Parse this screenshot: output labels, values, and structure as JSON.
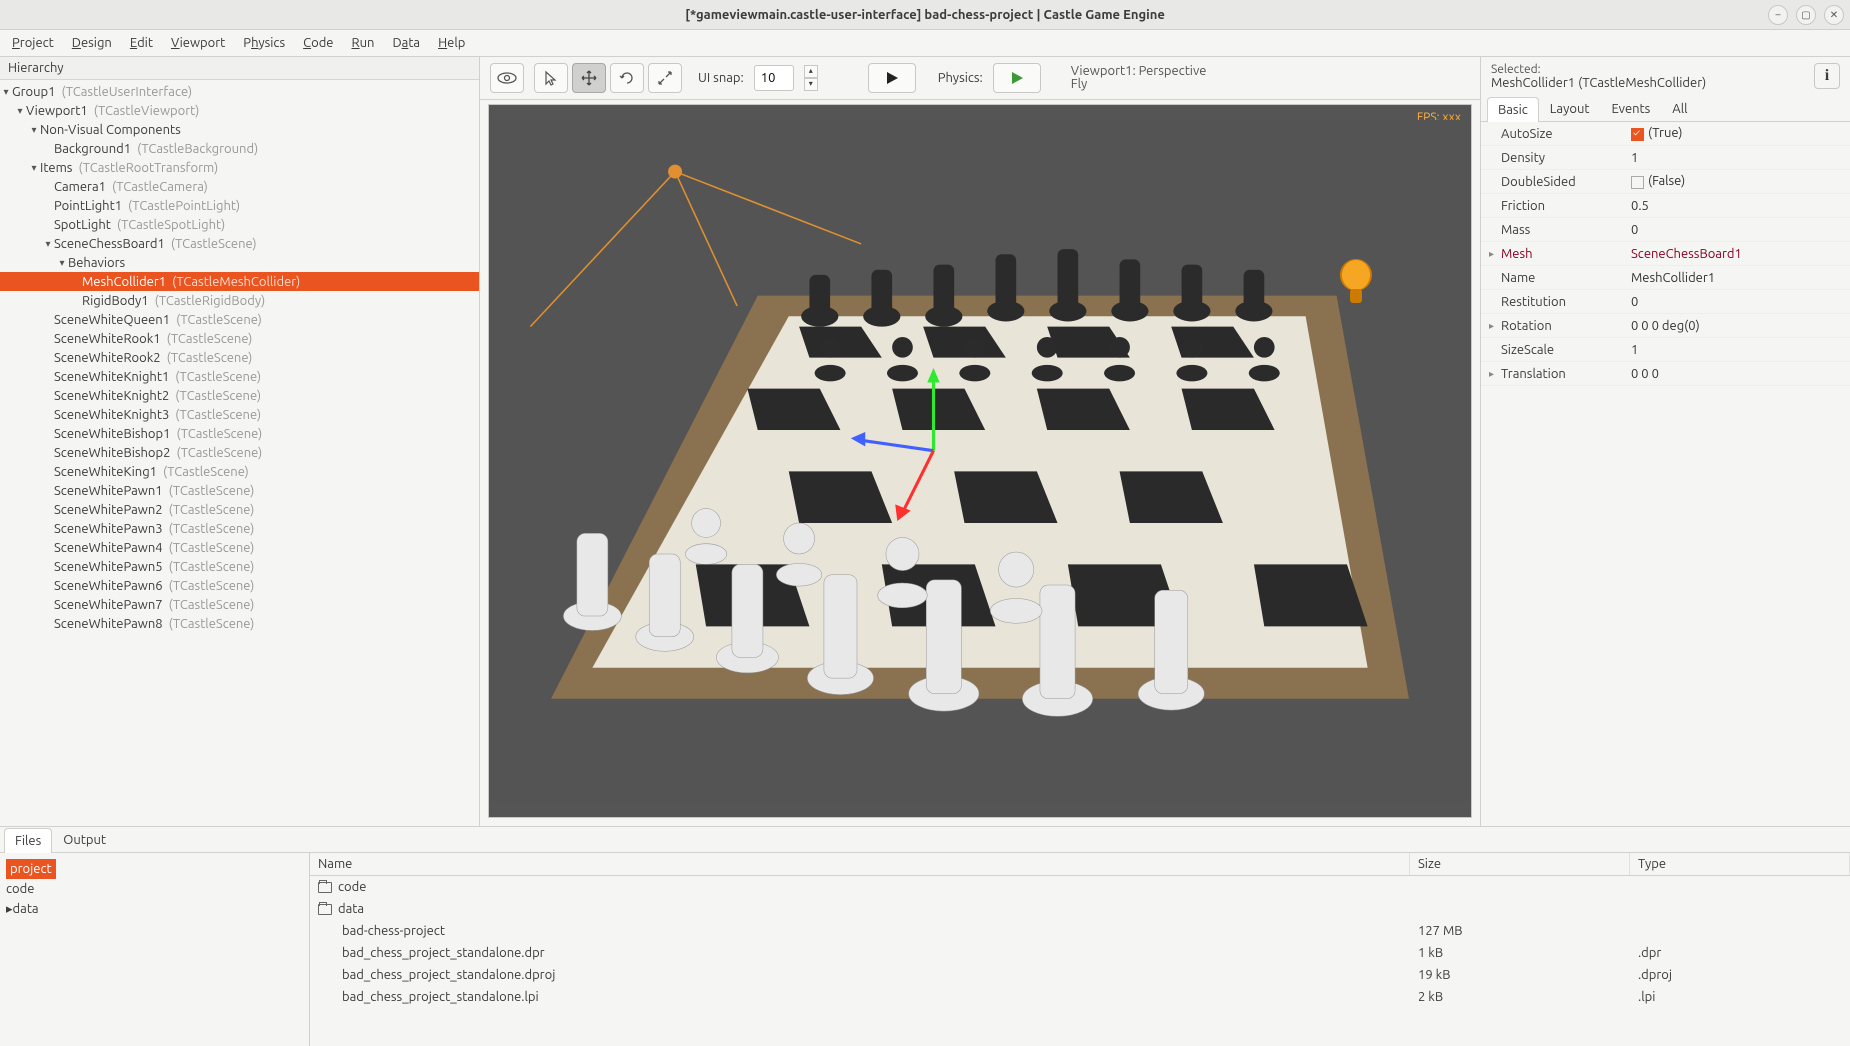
{
  "window_title": "[*gameviewmain.castle-user-interface] bad-chess-project | Castle Game Engine",
  "menu": [
    "Project",
    "Design",
    "Edit",
    "Viewport",
    "Physics",
    "Code",
    "Run",
    "Data",
    "Help"
  ],
  "hierarchy_label": "Hierarchy",
  "tree": [
    {
      "d": 0,
      "a": "▾",
      "n": "Group1",
      "c": "(TCastleUserInterface)"
    },
    {
      "d": 1,
      "a": "▾",
      "n": "Viewport1",
      "c": "(TCastleViewport)"
    },
    {
      "d": 2,
      "a": "▾",
      "n": "Non-Visual Components",
      "c": ""
    },
    {
      "d": 3,
      "a": "",
      "n": "Background1",
      "c": "(TCastleBackground)"
    },
    {
      "d": 2,
      "a": "▾",
      "n": "Items",
      "c": "(TCastleRootTransform)"
    },
    {
      "d": 3,
      "a": "",
      "n": "Camera1",
      "c": "(TCastleCamera)"
    },
    {
      "d": 3,
      "a": "",
      "n": "PointLight1",
      "c": "(TCastlePointLight)"
    },
    {
      "d": 3,
      "a": "",
      "n": "SpotLight",
      "c": "(TCastleSpotLight)"
    },
    {
      "d": 3,
      "a": "▾",
      "n": "SceneChessBoard1",
      "c": "(TCastleScene)"
    },
    {
      "d": 4,
      "a": "▾",
      "n": "Behaviors",
      "c": ""
    },
    {
      "d": 5,
      "a": "",
      "n": "MeshCollider1",
      "c": "(TCastleMeshCollider)",
      "sel": true
    },
    {
      "d": 5,
      "a": "",
      "n": "RigidBody1",
      "c": "(TCastleRigidBody)"
    },
    {
      "d": 3,
      "a": "",
      "n": "SceneWhiteQueen1",
      "c": "(TCastleScene)"
    },
    {
      "d": 3,
      "a": "",
      "n": "SceneWhiteRook1",
      "c": "(TCastleScene)"
    },
    {
      "d": 3,
      "a": "",
      "n": "SceneWhiteRook2",
      "c": "(TCastleScene)"
    },
    {
      "d": 3,
      "a": "",
      "n": "SceneWhiteKnight1",
      "c": "(TCastleScene)"
    },
    {
      "d": 3,
      "a": "",
      "n": "SceneWhiteKnight2",
      "c": "(TCastleScene)"
    },
    {
      "d": 3,
      "a": "",
      "n": "SceneWhiteKnight3",
      "c": "(TCastleScene)"
    },
    {
      "d": 3,
      "a": "",
      "n": "SceneWhiteBishop1",
      "c": "(TCastleScene)"
    },
    {
      "d": 3,
      "a": "",
      "n": "SceneWhiteBishop2",
      "c": "(TCastleScene)"
    },
    {
      "d": 3,
      "a": "",
      "n": "SceneWhiteKing1",
      "c": "(TCastleScene)"
    },
    {
      "d": 3,
      "a": "",
      "n": "SceneWhitePawn1",
      "c": "(TCastleScene)"
    },
    {
      "d": 3,
      "a": "",
      "n": "SceneWhitePawn2",
      "c": "(TCastleScene)"
    },
    {
      "d": 3,
      "a": "",
      "n": "SceneWhitePawn3",
      "c": "(TCastleScene)"
    },
    {
      "d": 3,
      "a": "",
      "n": "SceneWhitePawn4",
      "c": "(TCastleScene)"
    },
    {
      "d": 3,
      "a": "",
      "n": "SceneWhitePawn5",
      "c": "(TCastleScene)"
    },
    {
      "d": 3,
      "a": "",
      "n": "SceneWhitePawn6",
      "c": "(TCastleScene)"
    },
    {
      "d": 3,
      "a": "",
      "n": "SceneWhitePawn7",
      "c": "(TCastleScene)"
    },
    {
      "d": 3,
      "a": "",
      "n": "SceneWhitePawn8",
      "c": "(TCastleScene)"
    }
  ],
  "toolbar": {
    "uisnap_label": "UI snap:",
    "uisnap_value": "10",
    "physics_label": "Physics:",
    "camera_line1": "Viewport1: Perspective",
    "camera_line2": "Fly"
  },
  "viewport": {
    "fps": "FPS: xxx"
  },
  "inspector": {
    "selected_label": "Selected:",
    "selected_name": "MeshCollider1 (TCastleMeshCollider)",
    "tabs": [
      "Basic",
      "Layout",
      "Events",
      "All"
    ],
    "props": [
      {
        "n": "AutoSize",
        "v": "(True)",
        "chk": true
      },
      {
        "n": "Density",
        "v": "1"
      },
      {
        "n": "DoubleSided",
        "v": "(False)",
        "chk": false,
        "hasChk": true
      },
      {
        "n": "Friction",
        "v": "0.5"
      },
      {
        "n": "Mass",
        "v": "0"
      },
      {
        "n": "Mesh",
        "v": "SceneChessBoard1",
        "exp": "▸",
        "linked": true
      },
      {
        "n": "Name",
        "v": "MeshCollider1"
      },
      {
        "n": "Restitution",
        "v": "0"
      },
      {
        "n": "Rotation",
        "v": "0 0 0 deg(0)",
        "exp": "▸"
      },
      {
        "n": "SizeScale",
        "v": "1"
      },
      {
        "n": "Translation",
        "v": "0 0 0",
        "exp": "▸"
      }
    ]
  },
  "bottom": {
    "tabs": [
      "Files",
      "Output"
    ],
    "foldertree": [
      {
        "d": 0,
        "n": "project",
        "sel": true
      },
      {
        "d": 1,
        "n": "code"
      },
      {
        "d": 1,
        "n": "data",
        "a": "▸"
      }
    ],
    "columns": {
      "name": "Name",
      "size": "Size",
      "type": "Type"
    },
    "files": [
      {
        "n": "code",
        "folder": true
      },
      {
        "n": "data",
        "folder": true
      },
      {
        "n": "bad-chess-project",
        "s": "127 MB"
      },
      {
        "n": "bad_chess_project_standalone.dpr",
        "s": "1 kB",
        "t": ".dpr"
      },
      {
        "n": "bad_chess_project_standalone.dproj",
        "s": "19 kB",
        "t": ".dproj"
      },
      {
        "n": "bad_chess_project_standalone.lpi",
        "s": "2 kB",
        "t": ".lpi"
      }
    ]
  }
}
